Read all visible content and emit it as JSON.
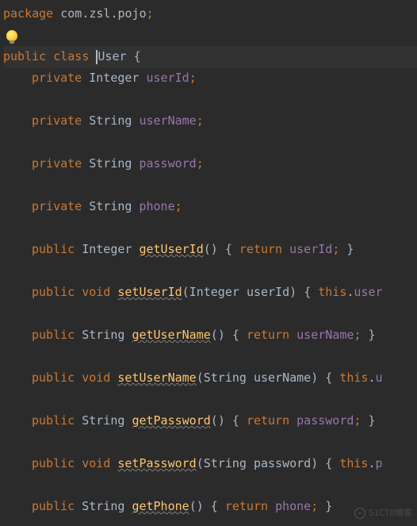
{
  "watermark": "51CTO博客",
  "code": {
    "package_kw": "package",
    "package_name": " com.zsl.pojo",
    "semicolon": ";",
    "public_kw": "public",
    "class_kw": "class",
    "private_kw": "private",
    "void_kw": "void",
    "return_kw": "return",
    "this_kw": "this",
    "classname": "User",
    "integer_type": "Integer",
    "string_type": "String",
    "fields": {
      "userId": "userId",
      "userName": "userName",
      "password": "password",
      "phone": "phone"
    },
    "methods": {
      "getUserId": "getUserId",
      "setUserId": "setUserId",
      "getUserName": "getUserName",
      "setUserName": "setUserName",
      "getPassword": "getPassword",
      "setPassword": "setPassword",
      "getPhone": "getPhone"
    },
    "params": {
      "userId": "userId",
      "userName": "userName",
      "password": "password"
    },
    "braces": {
      "open": "{",
      "close": "}",
      "paren_open": "(",
      "paren_close": ")"
    },
    "dot": ".",
    "truncated": {
      "user": "user",
      "u": "u",
      "p": "p"
    }
  }
}
